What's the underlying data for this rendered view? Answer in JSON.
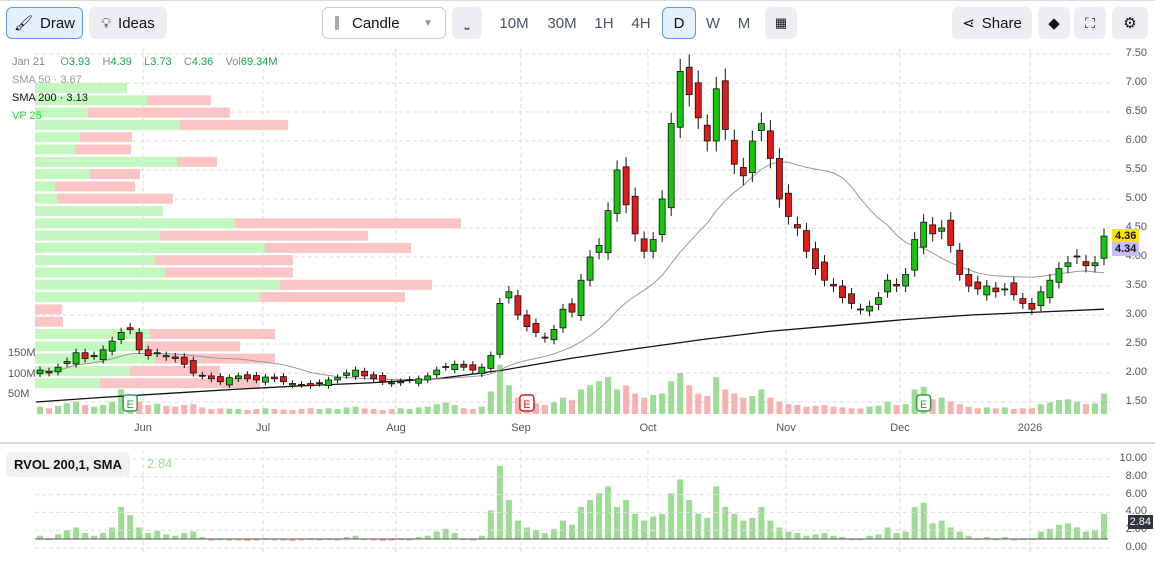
{
  "toolbar": {
    "draw": "Draw",
    "ideas": "Ideas",
    "chart_type": "Candle",
    "timeframes": [
      "10M",
      "30M",
      "1H",
      "4H",
      "D",
      "W",
      "M"
    ],
    "selected_timeframe": "D",
    "share": "Share"
  },
  "legend": {
    "date": "Jan 21",
    "o_label": "O",
    "o": "3.93",
    "h_label": "H",
    "h": "4.39",
    "l_label": "L",
    "l": "3.73",
    "c_label": "C",
    "c": "4.36",
    "vol_label": "Vol",
    "vol": "69.34M",
    "sma50": "SMA 50",
    "sma50_val": "3.67",
    "sma200": "SMA 200",
    "sma200_val": "3.13",
    "vp": "VP 25"
  },
  "colors": {
    "up": "#16c60c",
    "down": "#e21a1a",
    "vol_up": "#9ddc94",
    "vol_down": "#f7b1b1",
    "vp_up": "#c4f7bf",
    "vp_down": "#fcc5c5",
    "last_price": "#ffe600",
    "sma_tag": "#c6bef7"
  },
  "price_axis": [
    "7.50",
    "7.00",
    "6.50",
    "6.00",
    "5.50",
    "5.00",
    "4.50",
    "4.00",
    "3.50",
    "3.00",
    "2.50",
    "2.00",
    "1.50"
  ],
  "vol_axis": [
    "150M",
    "100M",
    "50M"
  ],
  "last_price": "4.36",
  "sma_price": "4.34",
  "x_axis": [
    "Jun",
    "Jul",
    "Aug",
    "Sep",
    "Oct",
    "Nov",
    "Dec",
    "2026"
  ],
  "earnings_marker": "E",
  "rvol": {
    "title": "RVOL 200,1, SMA",
    "value": "2.84",
    "axis": [
      "10.00",
      "8.00",
      "6.00",
      "4.00",
      "2.00",
      "0.00"
    ]
  },
  "chart_data": {
    "type": "candlestick",
    "price_range": [
      1.25,
      7.7
    ],
    "closes": [
      2.05,
      2.0,
      2.1,
      2.2,
      2.35,
      2.25,
      2.3,
      2.4,
      2.55,
      2.7,
      2.75,
      2.4,
      2.3,
      2.35,
      2.3,
      2.25,
      2.15,
      2.0,
      1.95,
      1.9,
      1.85,
      1.92,
      1.95,
      1.9,
      1.88,
      1.93,
      1.9,
      1.85,
      1.82,
      1.8,
      1.78,
      1.82,
      1.88,
      1.92,
      2.0,
      2.05,
      1.95,
      1.9,
      1.85,
      1.83,
      1.85,
      1.88,
      1.9,
      1.95,
      2.05,
      2.1,
      2.15,
      2.1,
      2.05,
      2.1,
      2.3,
      3.2,
      3.4,
      3.0,
      2.8,
      2.7,
      2.6,
      2.75,
      3.1,
      3.05,
      3.6,
      4.0,
      4.2,
      4.8,
      5.5,
      4.9,
      4.4,
      4.1,
      4.3,
      5.0,
      6.3,
      7.2,
      6.8,
      6.4,
      6.0,
      6.9,
      6.2,
      5.6,
      5.4,
      6.0,
      6.3,
      5.7,
      5.0,
      4.7,
      4.5,
      4.1,
      3.8,
      3.6,
      3.5,
      3.3,
      3.2,
      3.1,
      3.15,
      3.3,
      3.6,
      3.5,
      3.7,
      4.3,
      4.6,
      4.4,
      4.5,
      4.2,
      3.7,
      3.5,
      3.45,
      3.5,
      3.4,
      3.45,
      3.35,
      3.2,
      3.1,
      3.4,
      3.6,
      3.8,
      3.9,
      4.0,
      3.85,
      3.9,
      4.36
    ],
    "volumes_m": [
      18,
      14,
      20,
      26,
      30,
      22,
      18,
      22,
      30,
      60,
      48,
      30,
      22,
      25,
      20,
      18,
      22,
      24,
      16,
      12,
      14,
      13,
      12,
      10,
      12,
      14,
      12,
      11,
      10,
      12,
      14,
      12,
      14,
      12,
      16,
      18,
      14,
      12,
      10,
      12,
      14,
      12,
      16,
      18,
      24,
      28,
      22,
      14,
      12,
      18,
      55,
      120,
      70,
      40,
      30,
      26,
      22,
      28,
      40,
      34,
      60,
      70,
      80,
      90,
      60,
      70,
      50,
      40,
      46,
      50,
      80,
      100,
      70,
      50,
      44,
      90,
      60,
      50,
      40,
      44,
      60,
      40,
      30,
      24,
      22,
      18,
      20,
      22,
      18,
      16,
      14,
      14,
      18,
      20,
      30,
      22,
      24,
      60,
      66,
      36,
      40,
      30,
      24,
      18,
      14,
      16,
      14,
      16,
      12,
      14,
      14,
      24,
      28,
      34,
      36,
      30,
      24,
      26,
      50
    ],
    "sma200": [
      1.5,
      1.58,
      1.65,
      1.72,
      1.78,
      1.83,
      1.9,
      2.05,
      2.25,
      2.42,
      2.58,
      2.72,
      2.82,
      2.92,
      3.0,
      3.05,
      3.1
    ],
    "volume_profile": [
      [
        92,
        0
      ],
      [
        112,
        64
      ],
      [
        53,
        142
      ],
      [
        145,
        108
      ],
      [
        45,
        52
      ],
      [
        40,
        56
      ],
      [
        142,
        40
      ],
      [
        55,
        50
      ],
      [
        20,
        80
      ],
      [
        22,
        116
      ],
      [
        128,
        0
      ],
      [
        200,
        226
      ],
      [
        125,
        208
      ],
      [
        230,
        146
      ],
      [
        120,
        138
      ],
      [
        130,
        128
      ],
      [
        245,
        152
      ],
      [
        225,
        145
      ],
      [
        0,
        27
      ],
      [
        0,
        28
      ],
      [
        115,
        125
      ],
      [
        110,
        95
      ],
      [
        120,
        120
      ],
      [
        95,
        90
      ],
      [
        65,
        160
      ]
    ],
    "earnings": [
      {
        "index": 10,
        "color": "green"
      },
      {
        "index": 54,
        "color": "red"
      },
      {
        "index": 98,
        "color": "green"
      }
    ]
  }
}
